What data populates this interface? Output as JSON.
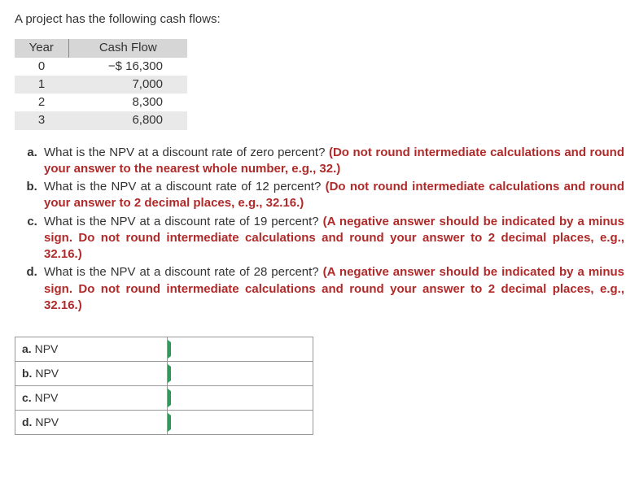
{
  "intro": "A project has the following cash flows:",
  "table": {
    "headers": [
      "Year",
      "Cash Flow"
    ],
    "rows": [
      {
        "year": "0",
        "cash": "−$ 16,300"
      },
      {
        "year": "1",
        "cash": "7,000"
      },
      {
        "year": "2",
        "cash": "8,300"
      },
      {
        "year": "3",
        "cash": "6,800"
      }
    ]
  },
  "questions": [
    {
      "text": "What is the NPV at a discount rate of zero percent? ",
      "hint": "(Do not round intermediate calculations and round your answer to the nearest whole number, e.g., 32.)"
    },
    {
      "text": "What is the NPV at a discount rate of 12 percent? ",
      "hint": "(Do not round intermediate calculations and round your answer to 2 decimal places, e.g., 32.16.)"
    },
    {
      "text": "What is the NPV at a discount rate of 19 percent? ",
      "hint": "(A negative answer should be indicated by a minus sign. Do not round intermediate calculations and round your answer to 2 decimal places, e.g., 32.16.)"
    },
    {
      "text": "What is the NPV at a discount rate of 28 percent? ",
      "hint": "(A negative answer should be indicated by a minus sign. Do not round intermediate calculations and round your answer to 2 decimal places, e.g., 32.16.)"
    }
  ],
  "answers": {
    "rows": [
      {
        "prefix": "a.",
        "label": " NPV"
      },
      {
        "prefix": "b.",
        "label": " NPV"
      },
      {
        "prefix": "c.",
        "label": " NPV"
      },
      {
        "prefix": "d.",
        "label": " NPV"
      }
    ]
  }
}
